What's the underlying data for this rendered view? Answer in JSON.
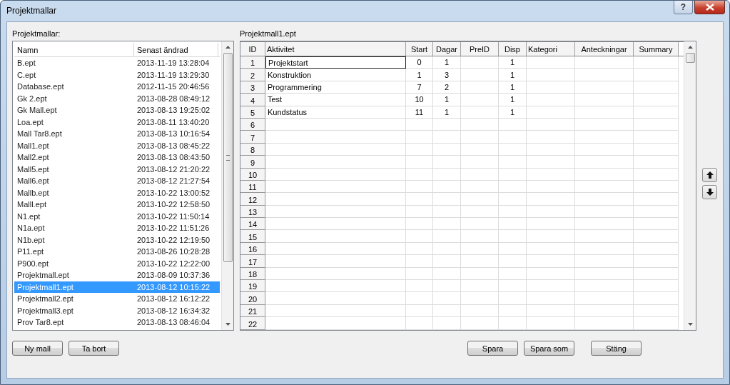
{
  "window": {
    "title": "Projektmallar",
    "help_button": "?"
  },
  "template_list": {
    "label": "Projektmallar:",
    "columns": [
      "Namn",
      "Senast ändrad"
    ],
    "items": [
      {
        "name": "B.ept",
        "modified": "2013-11-19 13:28:04",
        "selected": false
      },
      {
        "name": "C.ept",
        "modified": "2013-11-19 13:29:30",
        "selected": false
      },
      {
        "name": "Database.ept",
        "modified": "2012-11-15 20:46:56",
        "selected": false
      },
      {
        "name": "Gk 2.ept",
        "modified": "2013-08-28 08:49:12",
        "selected": false
      },
      {
        "name": "Gk Mall.ept",
        "modified": "2013-08-13 19:25:02",
        "selected": false
      },
      {
        "name": "Loa.ept",
        "modified": "2013-08-11 13:40:20",
        "selected": false
      },
      {
        "name": "Mall Tar8.ept",
        "modified": "2013-08-13 10:16:54",
        "selected": false
      },
      {
        "name": "Mall1.ept",
        "modified": "2013-08-13 08:45:22",
        "selected": false
      },
      {
        "name": "Mall2.ept",
        "modified": "2013-08-13 08:43:50",
        "selected": false
      },
      {
        "name": "Mall5.ept",
        "modified": "2013-08-12 21:20:22",
        "selected": false
      },
      {
        "name": "Mall6.ept",
        "modified": "2013-08-12 21:27:54",
        "selected": false
      },
      {
        "name": "Mallb.ept",
        "modified": "2013-10-22 13:00:52",
        "selected": false
      },
      {
        "name": "Malll.ept",
        "modified": "2013-10-22 12:58:50",
        "selected": false
      },
      {
        "name": "N1.ept",
        "modified": "2013-10-22 11:50:14",
        "selected": false
      },
      {
        "name": "N1a.ept",
        "modified": "2013-10-22 11:51:26",
        "selected": false
      },
      {
        "name": "N1b.ept",
        "modified": "2013-10-22 12:19:50",
        "selected": false
      },
      {
        "name": "P11.ept",
        "modified": "2013-08-26 10:28:28",
        "selected": false
      },
      {
        "name": "P900.ept",
        "modified": "2013-10-22 12:22:00",
        "selected": false
      },
      {
        "name": "Projektmall.ept",
        "modified": "2013-08-09 10:37:36",
        "selected": false
      },
      {
        "name": "Projektmall1.ept",
        "modified": "2013-08-12 10:15:22",
        "selected": true
      },
      {
        "name": "Projektmall2.ept",
        "modified": "2013-08-12 16:12:22",
        "selected": false
      },
      {
        "name": "Projektmall3.ept",
        "modified": "2013-08-12 16:34:32",
        "selected": false
      },
      {
        "name": "Prov Tar8.ept",
        "modified": "2013-08-13 08:46:04",
        "selected": false
      }
    ]
  },
  "grid": {
    "label": "Projektmall1.ept",
    "columns": [
      "ID",
      "Aktivitet",
      "Start",
      "Dagar",
      "PreID",
      "Disp",
      "Kategori",
      "Anteckningar",
      "Summary"
    ],
    "rows": [
      {
        "id": "1",
        "activity": "Projektstart",
        "start": "0",
        "days": "1",
        "disp": "1",
        "focused": true
      },
      {
        "id": "2",
        "activity": "Konstruktion",
        "start": "1",
        "days": "3",
        "disp": "1",
        "focused": false
      },
      {
        "id": "3",
        "activity": "Programmering",
        "start": "7",
        "days": "2",
        "disp": "1",
        "focused": false
      },
      {
        "id": "4",
        "activity": "Test",
        "start": "10",
        "days": "1",
        "disp": "1",
        "focused": false
      },
      {
        "id": "5",
        "activity": "Kundstatus",
        "start": "11",
        "days": "1",
        "disp": "1",
        "focused": false
      },
      {
        "id": "6"
      },
      {
        "id": "7"
      },
      {
        "id": "8"
      },
      {
        "id": "9"
      },
      {
        "id": "10"
      },
      {
        "id": "11"
      },
      {
        "id": "12"
      },
      {
        "id": "13"
      },
      {
        "id": "14"
      },
      {
        "id": "15"
      },
      {
        "id": "16"
      },
      {
        "id": "17"
      },
      {
        "id": "18"
      },
      {
        "id": "19"
      },
      {
        "id": "20"
      },
      {
        "id": "21"
      },
      {
        "id": "22"
      }
    ]
  },
  "buttons_left": [
    "Ny mall",
    "Ta bort"
  ],
  "buttons_right": [
    "Spara",
    "Spara som",
    "Stäng"
  ]
}
